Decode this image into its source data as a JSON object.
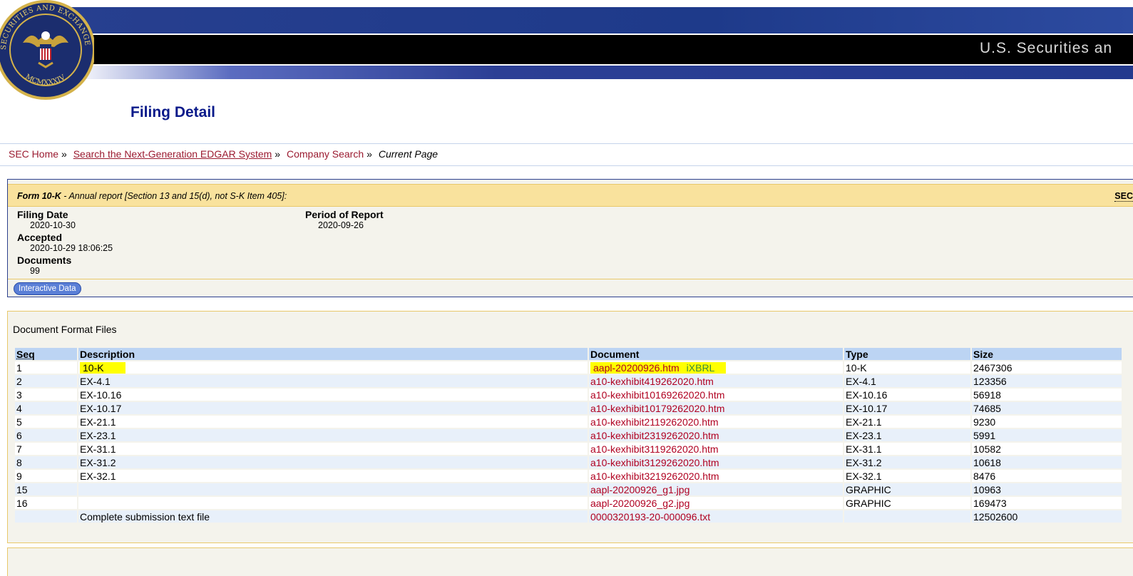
{
  "header": {
    "banner_title": "U.S. Securities an",
    "seal_text_top": "SECURITIES AND EXCHANGE COMMISSION",
    "seal_text_bottom": "MCMXXXIV",
    "colors": {
      "banner_blue": "#273f8f",
      "title_blue": "#0a1a8a"
    }
  },
  "page_title": "Filing Detail",
  "breadcrumb": {
    "items": [
      "SEC Home",
      "Search the Next-Generation EDGAR System",
      "Company Search"
    ],
    "separator": "»",
    "current": "Current Page"
  },
  "form": {
    "form_type": "Form 10-K",
    "description": " - Annual report [Section 13 and 15(d), not S-K Item 405]:",
    "sec_accession_label": "SEC",
    "filing_date_label": "Filing Date",
    "filing_date": "2020-10-30",
    "accepted_label": "Accepted",
    "accepted": "2020-10-29 18:06:25",
    "documents_label": "Documents",
    "documents": "99",
    "period_label": "Period of Report",
    "period": "2020-09-26",
    "interactive_data_button": "Interactive Data"
  },
  "documents_section": {
    "title": "Document Format Files",
    "columns": [
      "Seq",
      "Description",
      "Document",
      "Type",
      "Size"
    ],
    "ixbrl_label": "iXBRL",
    "rows": [
      {
        "seq": "1",
        "description": "10-K",
        "document": "aapl-20200926.htm",
        "type": "10-K",
        "size": "2467306"
      },
      {
        "seq": "2",
        "description": "EX-4.1",
        "document": "a10-kexhibit419262020.htm",
        "type": "EX-4.1",
        "size": "123356"
      },
      {
        "seq": "3",
        "description": "EX-10.16",
        "document": "a10-kexhibit10169262020.htm",
        "type": "EX-10.16",
        "size": "56918"
      },
      {
        "seq": "4",
        "description": "EX-10.17",
        "document": "a10-kexhibit10179262020.htm",
        "type": "EX-10.17",
        "size": "74685"
      },
      {
        "seq": "5",
        "description": "EX-21.1",
        "document": "a10-kexhibit2119262020.htm",
        "type": "EX-21.1",
        "size": "9230"
      },
      {
        "seq": "6",
        "description": "EX-23.1",
        "document": "a10-kexhibit2319262020.htm",
        "type": "EX-23.1",
        "size": "5991"
      },
      {
        "seq": "7",
        "description": "EX-31.1",
        "document": "a10-kexhibit3119262020.htm",
        "type": "EX-31.1",
        "size": "10582"
      },
      {
        "seq": "8",
        "description": "EX-31.2",
        "document": "a10-kexhibit3129262020.htm",
        "type": "EX-31.2",
        "size": "10618"
      },
      {
        "seq": "9",
        "description": "EX-32.1",
        "document": "a10-kexhibit3219262020.htm",
        "type": "EX-32.1",
        "size": "8476"
      },
      {
        "seq": "15",
        "description": "",
        "document": "aapl-20200926_g1.jpg",
        "type": "GRAPHIC",
        "size": "10963"
      },
      {
        "seq": "16",
        "description": "",
        "document": "aapl-20200926_g2.jpg",
        "type": "GRAPHIC",
        "size": "169473"
      },
      {
        "seq": "",
        "description": "Complete submission text file",
        "document": "0000320193-20-000096.txt",
        "type": "",
        "size": "12502600"
      }
    ]
  }
}
